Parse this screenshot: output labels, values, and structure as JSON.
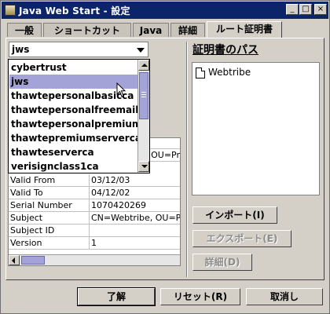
{
  "window": {
    "title": "Java Web Start - 設定"
  },
  "tabs": [
    "一般",
    "ショートカット",
    "Java",
    "詳細",
    "ルート証明書"
  ],
  "combo": {
    "selected": "jws"
  },
  "dropdown": {
    "items": [
      "cybertrust",
      "jws",
      "thawtepersonalbasicca",
      "thawtepersonalfreemailca",
      "thawtepersonalpremiumca",
      "thawtepremiumserverca",
      "thawteserverca",
      "verisignclass1ca"
    ],
    "selected_index": 1
  },
  "table": {
    "partial_row": "OU=Pr",
    "rows": [
      [
        "Valid From",
        "03/12/03"
      ],
      [
        "Valid To",
        "04/12/02"
      ],
      [
        "Serial Number",
        "1070420269"
      ],
      [
        "Subject",
        "CN=Webtribe, OU=Pr"
      ],
      [
        "Subject ID",
        ""
      ],
      [
        "Version",
        "1"
      ]
    ]
  },
  "cert_path": {
    "title": "証明書のパス",
    "items": [
      "Webtribe"
    ]
  },
  "buttons": {
    "import": "インポート(I)",
    "export": "エクスポート(E)",
    "details": "詳細(D)",
    "ok": "了解",
    "reset": "リセット(R)",
    "cancel": "取消し"
  },
  "colors": {
    "titlebar": "#0b246a",
    "selection": "#a3a3d8",
    "face": "#d4d0c8"
  }
}
